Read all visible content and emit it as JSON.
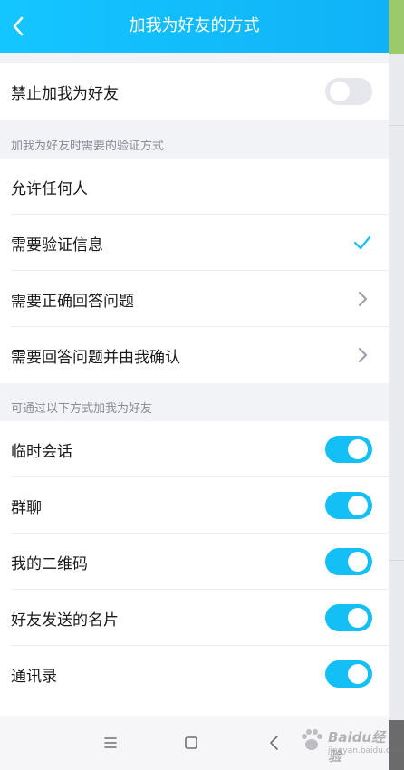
{
  "header": {
    "title": "加我为好友的方式",
    "back_icon": "chevron-left-icon"
  },
  "block_row": {
    "label": "禁止加我为好友",
    "enabled": false
  },
  "verification": {
    "section_label": "加我为好友时需要的验证方式",
    "options": [
      {
        "label": "允许任何人",
        "indicator": "none"
      },
      {
        "label": "需要验证信息",
        "indicator": "check-icon"
      },
      {
        "label": "需要正确回答问题",
        "indicator": "chevron-right-icon"
      },
      {
        "label": "需要回答问题并由我确认",
        "indicator": "chevron-right-icon"
      }
    ]
  },
  "sources": {
    "section_label": "可通过以下方式加我为好友",
    "items": [
      {
        "label": "临时会话",
        "enabled": true
      },
      {
        "label": "群聊",
        "enabled": true
      },
      {
        "label": "我的二维码",
        "enabled": true
      },
      {
        "label": "好友发送的名片",
        "enabled": true
      },
      {
        "label": "通讯录",
        "enabled": true
      }
    ]
  },
  "navbar": {
    "icons": [
      "menu-icon",
      "home-square-icon",
      "back-triangle-icon"
    ]
  },
  "watermark": {
    "text": "Baidu经验",
    "sub": "jingyan.baidu.com"
  },
  "colors": {
    "accent": "#13bff5",
    "header_start": "#14c6ff",
    "header_end": "#10b2f7"
  }
}
